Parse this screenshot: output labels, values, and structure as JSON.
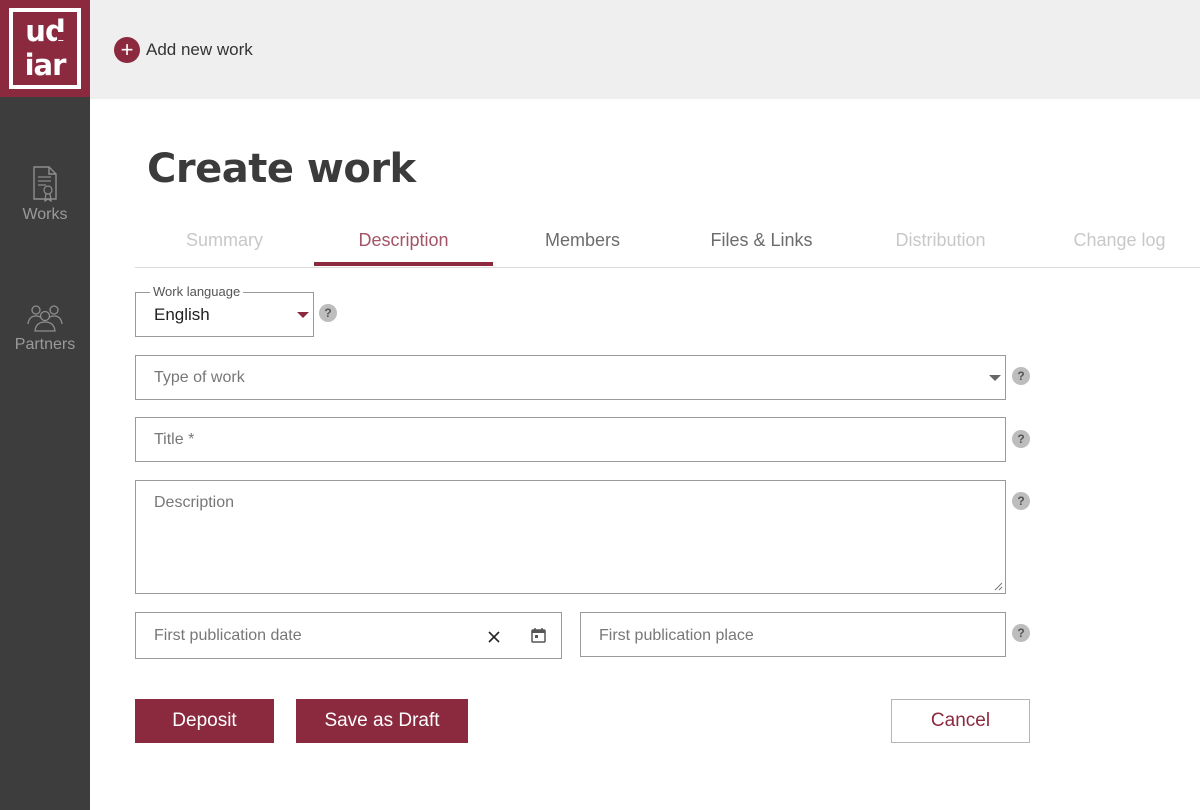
{
  "brand": {
    "logo_line1": "ud",
    "logo_line2": "iar",
    "accent_color": "#8b2a3e"
  },
  "sidebar": {
    "items": [
      {
        "label": "Works",
        "icon": "document-certificate-icon"
      },
      {
        "label": "Partners",
        "icon": "people-group-icon"
      }
    ]
  },
  "topbar": {
    "add_icon": "plus-circle-icon",
    "add_label": "Add new work"
  },
  "page": {
    "title": "Create work"
  },
  "tabs": [
    {
      "label": "Summary",
      "state": "disabled"
    },
    {
      "label": "Description",
      "state": "active"
    },
    {
      "label": "Members",
      "state": "normal"
    },
    {
      "label": "Files & Links",
      "state": "normal"
    },
    {
      "label": "Distribution",
      "state": "disabled"
    },
    {
      "label": "Change log",
      "state": "disabled"
    }
  ],
  "form": {
    "work_language": {
      "label": "Work language",
      "value": "English"
    },
    "type_of_work": {
      "placeholder": "Type of work"
    },
    "title": {
      "placeholder": "Title *"
    },
    "description": {
      "placeholder": "Description"
    },
    "first_publication_date": {
      "placeholder": "First publication date"
    },
    "first_publication_place": {
      "placeholder": "First publication place"
    },
    "help_glyph": "?"
  },
  "actions": {
    "deposit": "Deposit",
    "save_draft": "Save as Draft",
    "cancel": "Cancel"
  }
}
